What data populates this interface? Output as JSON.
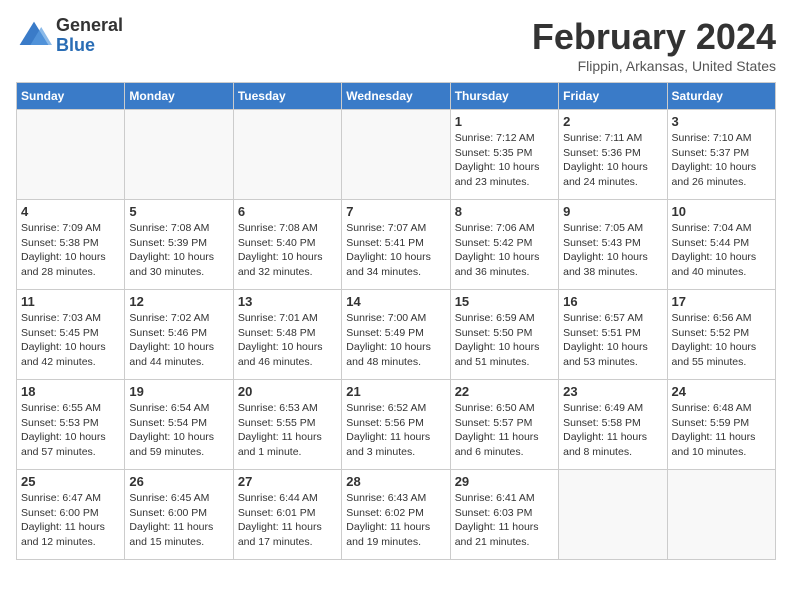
{
  "header": {
    "logo": {
      "general": "General",
      "blue": "Blue"
    },
    "title": "February 2024",
    "location": "Flippin, Arkansas, United States"
  },
  "weekdays": [
    "Sunday",
    "Monday",
    "Tuesday",
    "Wednesday",
    "Thursday",
    "Friday",
    "Saturday"
  ],
  "weeks": [
    [
      {
        "day": "",
        "info": ""
      },
      {
        "day": "",
        "info": ""
      },
      {
        "day": "",
        "info": ""
      },
      {
        "day": "",
        "info": ""
      },
      {
        "day": "1",
        "info": "Sunrise: 7:12 AM\nSunset: 5:35 PM\nDaylight: 10 hours\nand 23 minutes."
      },
      {
        "day": "2",
        "info": "Sunrise: 7:11 AM\nSunset: 5:36 PM\nDaylight: 10 hours\nand 24 minutes."
      },
      {
        "day": "3",
        "info": "Sunrise: 7:10 AM\nSunset: 5:37 PM\nDaylight: 10 hours\nand 26 minutes."
      }
    ],
    [
      {
        "day": "4",
        "info": "Sunrise: 7:09 AM\nSunset: 5:38 PM\nDaylight: 10 hours\nand 28 minutes."
      },
      {
        "day": "5",
        "info": "Sunrise: 7:08 AM\nSunset: 5:39 PM\nDaylight: 10 hours\nand 30 minutes."
      },
      {
        "day": "6",
        "info": "Sunrise: 7:08 AM\nSunset: 5:40 PM\nDaylight: 10 hours\nand 32 minutes."
      },
      {
        "day": "7",
        "info": "Sunrise: 7:07 AM\nSunset: 5:41 PM\nDaylight: 10 hours\nand 34 minutes."
      },
      {
        "day": "8",
        "info": "Sunrise: 7:06 AM\nSunset: 5:42 PM\nDaylight: 10 hours\nand 36 minutes."
      },
      {
        "day": "9",
        "info": "Sunrise: 7:05 AM\nSunset: 5:43 PM\nDaylight: 10 hours\nand 38 minutes."
      },
      {
        "day": "10",
        "info": "Sunrise: 7:04 AM\nSunset: 5:44 PM\nDaylight: 10 hours\nand 40 minutes."
      }
    ],
    [
      {
        "day": "11",
        "info": "Sunrise: 7:03 AM\nSunset: 5:45 PM\nDaylight: 10 hours\nand 42 minutes."
      },
      {
        "day": "12",
        "info": "Sunrise: 7:02 AM\nSunset: 5:46 PM\nDaylight: 10 hours\nand 44 minutes."
      },
      {
        "day": "13",
        "info": "Sunrise: 7:01 AM\nSunset: 5:48 PM\nDaylight: 10 hours\nand 46 minutes."
      },
      {
        "day": "14",
        "info": "Sunrise: 7:00 AM\nSunset: 5:49 PM\nDaylight: 10 hours\nand 48 minutes."
      },
      {
        "day": "15",
        "info": "Sunrise: 6:59 AM\nSunset: 5:50 PM\nDaylight: 10 hours\nand 51 minutes."
      },
      {
        "day": "16",
        "info": "Sunrise: 6:57 AM\nSunset: 5:51 PM\nDaylight: 10 hours\nand 53 minutes."
      },
      {
        "day": "17",
        "info": "Sunrise: 6:56 AM\nSunset: 5:52 PM\nDaylight: 10 hours\nand 55 minutes."
      }
    ],
    [
      {
        "day": "18",
        "info": "Sunrise: 6:55 AM\nSunset: 5:53 PM\nDaylight: 10 hours\nand 57 minutes."
      },
      {
        "day": "19",
        "info": "Sunrise: 6:54 AM\nSunset: 5:54 PM\nDaylight: 10 hours\nand 59 minutes."
      },
      {
        "day": "20",
        "info": "Sunrise: 6:53 AM\nSunset: 5:55 PM\nDaylight: 11 hours\nand 1 minute."
      },
      {
        "day": "21",
        "info": "Sunrise: 6:52 AM\nSunset: 5:56 PM\nDaylight: 11 hours\nand 3 minutes."
      },
      {
        "day": "22",
        "info": "Sunrise: 6:50 AM\nSunset: 5:57 PM\nDaylight: 11 hours\nand 6 minutes."
      },
      {
        "day": "23",
        "info": "Sunrise: 6:49 AM\nSunset: 5:58 PM\nDaylight: 11 hours\nand 8 minutes."
      },
      {
        "day": "24",
        "info": "Sunrise: 6:48 AM\nSunset: 5:59 PM\nDaylight: 11 hours\nand 10 minutes."
      }
    ],
    [
      {
        "day": "25",
        "info": "Sunrise: 6:47 AM\nSunset: 6:00 PM\nDaylight: 11 hours\nand 12 minutes."
      },
      {
        "day": "26",
        "info": "Sunrise: 6:45 AM\nSunset: 6:00 PM\nDaylight: 11 hours\nand 15 minutes."
      },
      {
        "day": "27",
        "info": "Sunrise: 6:44 AM\nSunset: 6:01 PM\nDaylight: 11 hours\nand 17 minutes."
      },
      {
        "day": "28",
        "info": "Sunrise: 6:43 AM\nSunset: 6:02 PM\nDaylight: 11 hours\nand 19 minutes."
      },
      {
        "day": "29",
        "info": "Sunrise: 6:41 AM\nSunset: 6:03 PM\nDaylight: 11 hours\nand 21 minutes."
      },
      {
        "day": "",
        "info": ""
      },
      {
        "day": "",
        "info": ""
      }
    ]
  ]
}
